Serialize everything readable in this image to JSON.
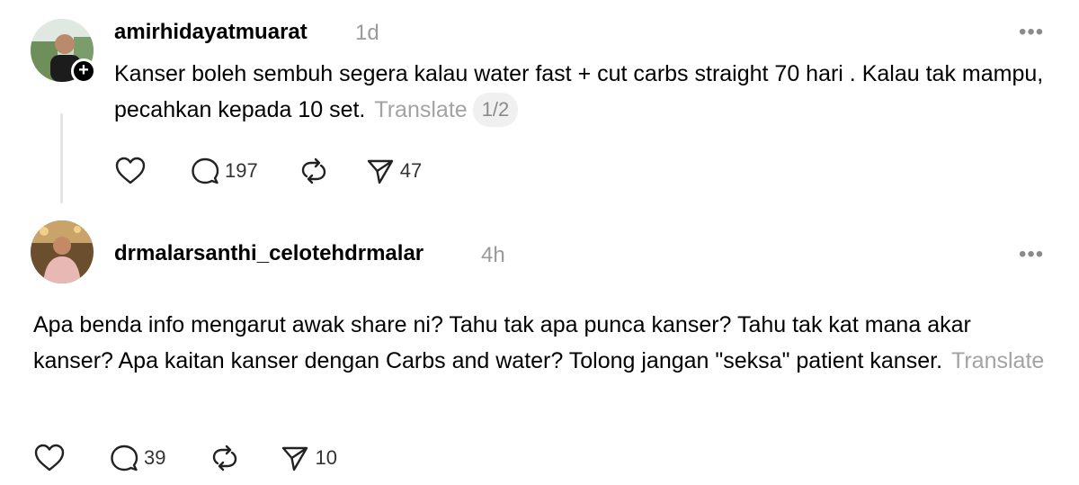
{
  "posts": [
    {
      "username": "amirhidayatmuarat",
      "time": "1d",
      "text": "Kanser boleh sembuh segera kalau water fast + cut carbs straight 70 hari . Kalau tak mampu, pecahkan kepada 10 set.",
      "translate_label": "Translate",
      "page_indicator": "1/2",
      "more_label": "•••",
      "follow_label": "+",
      "reply_count": "197",
      "share_count": "47"
    },
    {
      "username": "drmalarsanthi_celotehdrmalar",
      "time": "4h",
      "text": "Apa benda info mengarut awak share ni? Tahu tak apa punca kanser? Tahu tak kat mana akar kanser? Apa kaitan kanser dengan Carbs and water? Tolong jangan \"seksa\" patient kanser.",
      "translate_label": "Translate",
      "more_label": "•••",
      "reply_count": "39",
      "share_count": "10"
    }
  ],
  "icons": {
    "like": "heart-icon",
    "reply": "comment-icon",
    "repost": "repost-icon",
    "share": "send-icon"
  }
}
